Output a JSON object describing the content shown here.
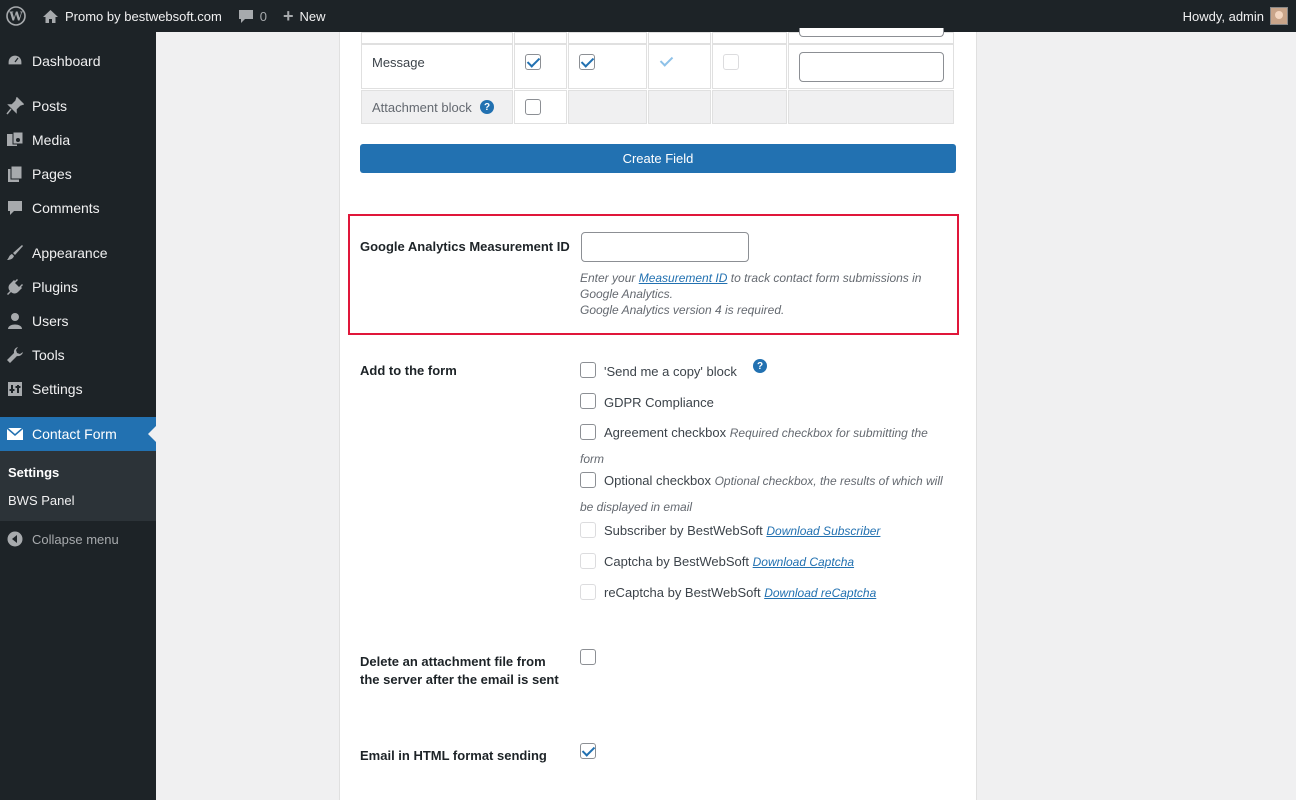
{
  "adminbar": {
    "site_name": "Promo by bestwebsoft.com",
    "comments_count": "0",
    "new_label": "New",
    "greeting": "Howdy, admin"
  },
  "sidebar": {
    "items": [
      {
        "label": "Dashboard",
        "icon": "dashboard-icon"
      },
      {
        "label": "Posts",
        "icon": "pin-icon"
      },
      {
        "label": "Media",
        "icon": "media-icon"
      },
      {
        "label": "Pages",
        "icon": "pages-icon"
      },
      {
        "label": "Comments",
        "icon": "comments-icon"
      },
      {
        "label": "Appearance",
        "icon": "brush-icon"
      },
      {
        "label": "Plugins",
        "icon": "plugin-icon"
      },
      {
        "label": "Users",
        "icon": "user-icon"
      },
      {
        "label": "Tools",
        "icon": "wrench-icon"
      },
      {
        "label": "Settings",
        "icon": "settings-icon"
      },
      {
        "label": "Contact Form",
        "icon": "envelope-icon"
      }
    ],
    "submenu": [
      "Settings",
      "BWS Panel"
    ],
    "collapse_label": "Collapse menu"
  },
  "fields_table": {
    "rows": [
      {
        "label": "Message"
      },
      {
        "label": "Attachment block"
      }
    ]
  },
  "create_field_label": "Create Field",
  "ga": {
    "label": "Google Analytics Measurement ID",
    "input_value": "",
    "desc_prefix": "Enter your ",
    "desc_link": "Measurement ID",
    "desc_suffix": " to track contact form submissions in Google Analytics.",
    "desc_line2": "Google Analytics version 4 is required."
  },
  "add_to_form": {
    "label": "Add to the form",
    "options": [
      {
        "label": "'Send me a copy' block",
        "desc": ""
      },
      {
        "label": "GDPR Compliance",
        "desc": ""
      },
      {
        "label": "Agreement checkbox",
        "desc": "Required checkbox for submitting the form"
      },
      {
        "label": "Optional checkbox",
        "desc": "Optional checkbox, the results of which will be displayed in email"
      },
      {
        "label": "Subscriber by BestWebSoft",
        "link": "Download Subscriber"
      },
      {
        "label": "Captcha by BestWebSoft",
        "link": "Download Captcha"
      },
      {
        "label": "reCaptcha by BestWebSoft",
        "link": "Download reCaptcha"
      }
    ]
  },
  "delete_attachment": {
    "label": "Delete an attachment file from the server after the email is sent",
    "checked": false
  },
  "html_format": {
    "label": "Email in HTML format sending",
    "checked": true
  },
  "colors": {
    "accent": "#2271b1",
    "highlight": "#e0173a",
    "sidebar_bg": "#1d2327"
  }
}
